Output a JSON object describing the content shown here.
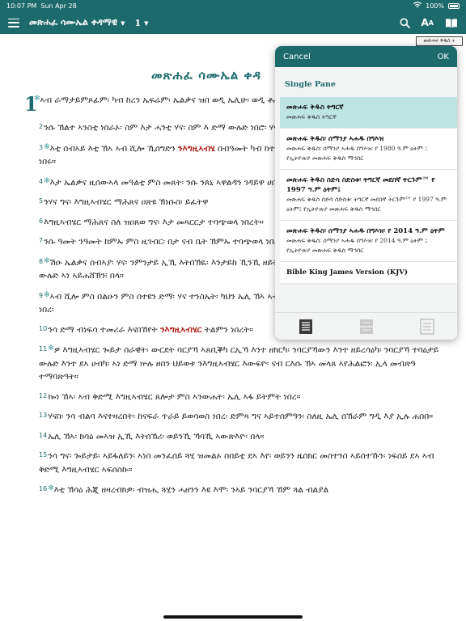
{
  "status": {
    "time": "10:07 PM",
    "date": "Sun Apr 28",
    "battery": "100%"
  },
  "nav": {
    "book": "መጽሐፈ ሳሙኤል ቀዳማዊ",
    "chapter": "1"
  },
  "corner_tag": "መጽሐፍ ቅዱስ ት",
  "title": "መጽሐፈ ሳሙኤል ቀዳ",
  "verses": [
    {
      "n": "1",
      "star": true,
      "parts": [
        {
          "t": "ኣብ ራማታይምጾፊም፡ ካብ ከረን ኤፍሬም፡ ኤልቃና ዝበ ወዲ ኤሊሁ፡ ወዲ ቶሑ፡ ወዲ ጹፍ፡ ነበረ።"
        }
      ]
    },
    {
      "n": "2",
      "star": false,
      "parts": [
        {
          "t": "ንሱ ኽልተ ኣንስቲ ነበራኦ፡ ስም እታ ሓንቲ ሃና፡ ስም እ ድማ ውሉድ ነበሮ፡ ሃና ግና ውሉድ ኣይነበሮን።"
        }
      ]
    },
    {
      "n": "3",
      "star": true,
      "parts": [
        {
          "t": "እቲ ሰብኣይ እቲ ኽኣ ኣብ ሺሎ ኺሰግድን "
        },
        {
          "t": "ንእግዚኣብሄ",
          "lord": true
        },
        {
          "t": " በብዓመት ካብ ከተማኡ ይድይብ ነበረ፡ ኣብኡ ኽልቲኦም እግዚኣብሄር ነበሩ።"
        }
      ]
    },
    {
      "n": "4",
      "star": true,
      "parts": [
        {
          "t": "እታ ኤልቃና ዚሰውኣላ መዓልቲ ምስ መጸት፡ ንሱ ንጰኒ ኣዋልዳን ገዳይዋ ሀበም።"
        }
      ]
    },
    {
      "n": "5",
      "star": false,
      "parts": [
        {
          "t": "ንሃና ግና፡ እግዚኣብሄር ማሕጸና ዐጽዩ ኽነሱስ፡ ይፈትዋ"
        }
      ]
    },
    {
      "n": "6",
      "star": false,
      "parts": [
        {
          "t": "እግዚኣብሄር ማሕጸና ስለ ዝዐጸወ ግና፡ እታ መጻርርታ ተባጭወላ ነበረት።"
        }
      ]
    },
    {
      "n": "7",
      "star": false,
      "parts": [
        {
          "t": "ንሱ ዓመት ንዓመት ከምኡ ምስ ዚገብር፡ በታ ናብ ቤት ኽምኡ ተባጭወላ ነበረት፡ ንሳ ኽኣ በኸየት፡ ኣይበልዐትን ድ"
        }
      ]
    },
    {
      "n": "8",
      "star": true,
      "parts": [
        {
          "t": "ሽዑ ኤልቃና ሰብኣያ፡ ሃና፡ ንምንታይ ኢኺ እትበኽዪ፡ እንታይከ ኺንኺ ዘይትበልዒ፡ እንታይ ኳንክስ ልብኺ ጉህዩ ኣሎ፡ ካብ ዓሰርተ ውሉድ ኣነ ኣይሐሸኽን፧ በላ።"
        }
      ]
    },
    {
      "n": "9",
      "star": true,
      "parts": [
        {
          "t": "ኣብ ሺሎ ምስ በልዑን ምስ ሰተዩን ድማ፡ ሃና ተንስኤት፡ ካህን ኤሊ ኽኣ ኣብ ኣፍ ደገ መቕደስ እግዚኣብሄር ኣብ መንበር ኮፍ ኢሉ ነበረ፡"
        }
      ]
    },
    {
      "n": "10",
      "star": false,
      "parts": [
        {
          "t": "ንሳ ድማ ብነፍሳ ተመሪራ እናበኸየት "
        },
        {
          "t": "ንእግዚኣብሄር",
          "lord": true
        },
        {
          "t": " ትልምን ነበረት።"
        }
      ]
    },
    {
      "n": "11",
      "star": true,
      "parts": [
        {
          "t": "ዎ እግዚኣብሄር ጐይታ ሰራዊት፡ ውርደት ባርያኻ ኣጸቢቕካ ርኢኻ እንተ ዘክርካ፡ ንባርያኻውን እንተ ዘይረሳዕካ፡ ንባርያኻ ተባዕታይ ውሉድ እንተ ደኣ ሀብካ፡ ኣነ ድማ ኵሉ ዘበን ህይወቱ ንእግዚኣብሄር እውፍዮ፡ ናብ ርእሱ ኽኣ መላጸ ኣየሕልፎን፡ ኢላ መብጽዓ ተማባጽዓት።"
        }
      ]
    },
    {
      "n": "12",
      "star": false,
      "parts": [
        {
          "t": "ኰነ ኸኣ፡ ኣብ ቅድሚ እግዚኣብሄር ጸሎታ ምስ ኣንውሐት፡ ኤሊ ኣፋ ይትምት ነበረ።"
        }
      ]
    },
    {
      "n": "13",
      "star": false,
      "parts": [
        {
          "t": "ሃናስ፡ ንሳ ብልባ እናተዛረበት፡ ከናፍራ ጥራይ ይወሳወስ ነበረ፡ ድምጻ ግና ኣይተሰምዓን፡ ስለዚ ኤሊ ሰኽራም ግዲ እያ ኢሉ ሐሰበ።"
        }
      ]
    },
    {
      "n": "14",
      "star": false,
      "parts": [
        {
          "t": "ኤሊ ኸኣ፡ ክሳዕ መኣዝ ኢኺ እትሰኽሪ፡ ወይንኺ ኻባኺ ኣውጽእዮ፡ በላ።"
        }
      ]
    },
    {
      "n": "15",
      "star": false,
      "parts": [
        {
          "t": "ንሳ ግና፡ ጐይታይ፡ ኣይፋለይን፡ ኣነስ መንፈሰይ ጓሂ ዝመልኦ ሰበይቲ ደኣ እየ፡ ወይንን ዜሰክር መስተንስ ኣይሰተኹን፡ ነፍሰይ ደኣ ኣብ ቅድሚ እግዚኣብሄር ኣፍሰስኩ።"
        }
      ]
    },
    {
      "n": "16",
      "star": true,
      "parts": [
        {
          "t": "እቲ ኽሳዕ ሕጂ ዘዛረብክዎ፡ ብዝሒ ጓሂን ሓዘንን እዩ እሞ፡ ንኣይ ንባርያኻ ኸም ጓል ብልያል"
        }
      ]
    }
  ],
  "popup": {
    "cancel": "Cancel",
    "ok": "OK",
    "section": "Single Pane",
    "bibles": [
      {
        "name": "መጽሐፍ ቅዱስ ትግርኛ",
        "desc": "መጽሐፍ ቅዱስ ትግርኛ",
        "selected": true
      },
      {
        "name": "መጽሐፍ ቅዱስ፡ ሰማንያ ኣሐዱ በግእዝ",
        "desc": "መጽሐፍ ቅዱስ፡ ሰማንያ ኣሐዱ በግእዝ፡ የ 1980 ዓ.ም ዕትም ፤ የኢትዮጵያ መጽሐፍ ቅዱስ ማኅበር",
        "selected": false
      },
      {
        "name": "መጽሐፍ ቅዱስ ስድሳ ስድስቱ፡ ትግርኛ መደበኛ ትርጉም™ የ 1997 ዓ.ም ዕትም፤",
        "desc": "መጽሐፍ ቅዱስ ስድሳ ስድስቱ፡ ትግርኛ መደበኛ ትርጉም™ የ 1997 ዓ.ም ዕትም፤ የኢትዮጵያ መጽሐፍ ቅዱስ ማኅበር",
        "selected": false
      },
      {
        "name": "መጽሐፍ ቅዱስ፡ ሰማንያ ኣሐዱ በግእዝ፡ የ 2014 ዓ.ም ዕትም",
        "desc": "መጽሐፍ ቅዱስ፡ ሰማንያ ኣሐዱ በግእዝ፡ የ 2014 ዓ.ም ዕትም ፤ የኢትዮጵያ መጽሐፍ ቅዱስ ማኅበር",
        "selected": false
      },
      {
        "name": "Bible King James Version (KJV)",
        "desc": "",
        "selected": false
      }
    ]
  },
  "colors": {
    "accent": "#1d6a6c",
    "lord": "#b3261e",
    "selected": "#bfe5e2"
  }
}
